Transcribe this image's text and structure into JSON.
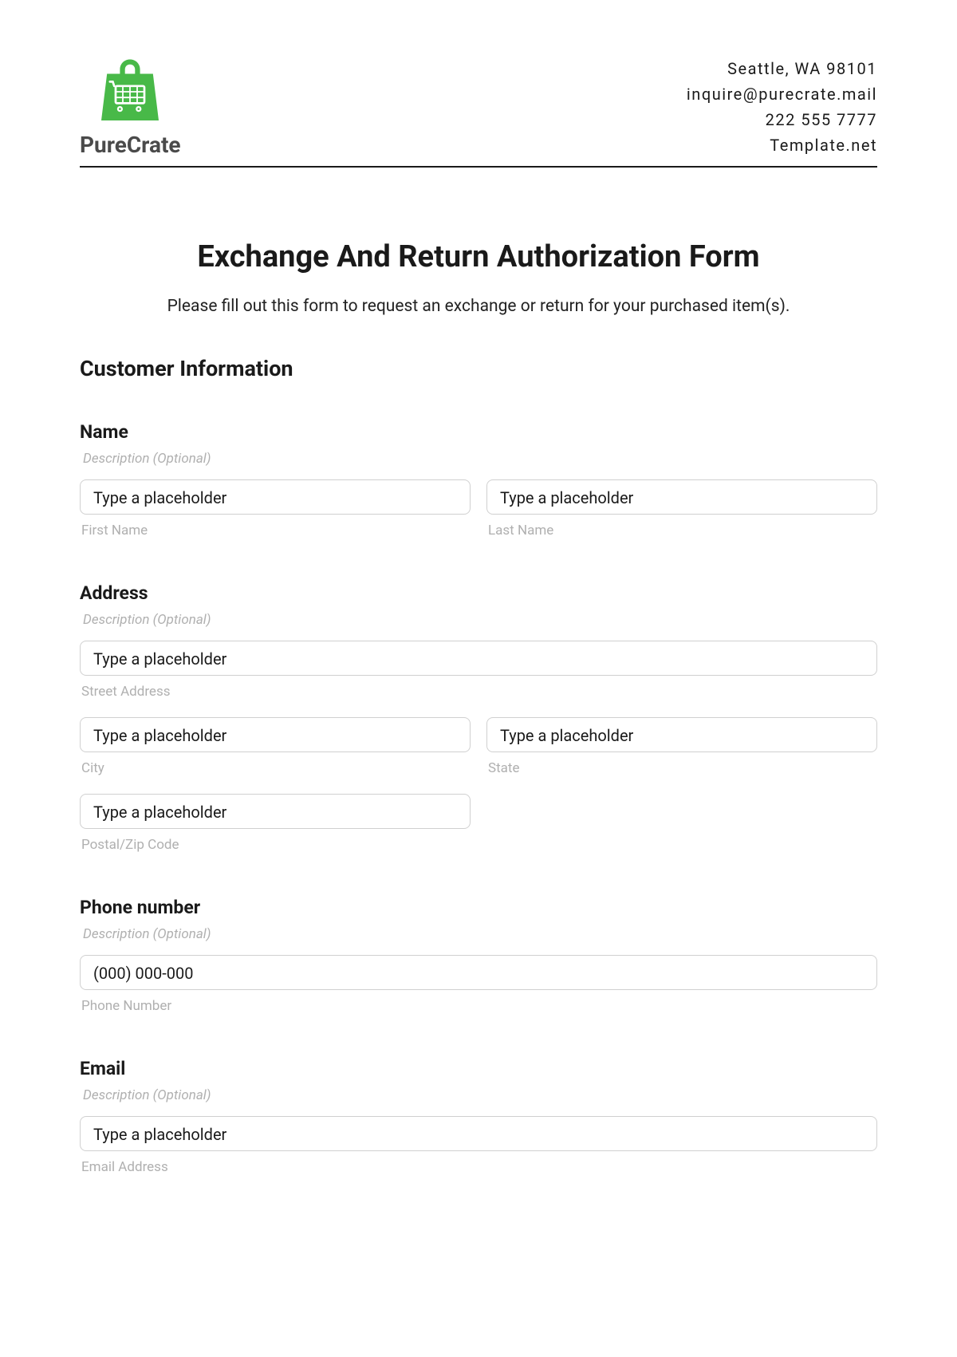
{
  "header": {
    "brand": "PureCrate",
    "contact": {
      "address": "Seattle, WA 98101",
      "email": "inquire@purecrate.mail",
      "phone": "222 555 7777",
      "site": "Template.net"
    }
  },
  "form": {
    "title": "Exchange And Return Authorization Form",
    "description": "Please fill out this form to request an exchange or return for your purchased item(s)."
  },
  "sections": {
    "customer_info": {
      "heading": "Customer Information"
    }
  },
  "fields": {
    "name": {
      "label": "Name",
      "desc": "Description (Optional)",
      "first": {
        "placeholder": "Type a placeholder",
        "sublabel": "First Name"
      },
      "last": {
        "placeholder": "Type a placeholder",
        "sublabel": "Last Name"
      }
    },
    "address": {
      "label": "Address",
      "desc": "Description (Optional)",
      "street": {
        "placeholder": "Type a placeholder",
        "sublabel": "Street Address"
      },
      "city": {
        "placeholder": "Type a placeholder",
        "sublabel": "City"
      },
      "state": {
        "placeholder": "Type a placeholder",
        "sublabel": "State"
      },
      "postal": {
        "placeholder": "Type a placeholder",
        "sublabel": "Postal/Zip Code"
      }
    },
    "phone": {
      "label": "Phone number",
      "desc": "Description (Optional)",
      "input": {
        "placeholder": "(000) 000-000",
        "sublabel": "Phone Number"
      }
    },
    "email": {
      "label": "Email",
      "desc": "Description (Optional)",
      "input": {
        "placeholder": "Type a placeholder",
        "sublabel": "Email Address"
      }
    }
  }
}
